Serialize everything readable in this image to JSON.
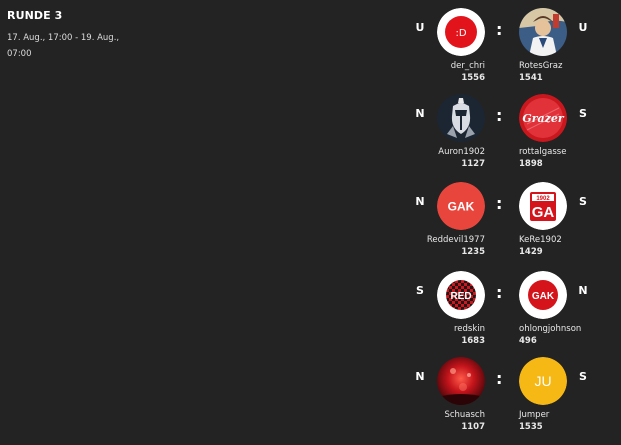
{
  "round": {
    "title": "RUNDE 3",
    "dates": "17. Aug., 17:00 - 19. Aug., 07:00"
  },
  "matches": [
    {
      "home": {
        "name": "der_chri",
        "rating": "1556",
        "result": "U",
        "avatar_icon": "smiley-text-avatar-icon",
        "avatar_text": ":D"
      },
      "away": {
        "name": "RotesGraz",
        "rating": "1541",
        "result": "U",
        "avatar_icon": "cartoon-character-avatar-icon"
      }
    },
    {
      "home": {
        "name": "Auron1902",
        "rating": "1127",
        "result": "N",
        "avatar_icon": "knight-avatar-icon"
      },
      "away": {
        "name": "rottalgasse",
        "rating": "1898",
        "result": "S",
        "avatar_icon": "grazer-club-badge-avatar-icon",
        "avatar_text": "Grazer"
      }
    },
    {
      "home": {
        "name": "Reddevil1977",
        "rating": "1235",
        "result": "N",
        "avatar_icon": "gak-text-avatar-icon",
        "avatar_text": "GAK"
      },
      "away": {
        "name": "KeRe1902",
        "rating": "1429",
        "result": "S",
        "avatar_icon": "ga-1902-badge-avatar-icon",
        "avatar_text": "GA",
        "avatar_year": "1902"
      }
    },
    {
      "home": {
        "name": "redskin",
        "rating": "1683",
        "result": "S",
        "avatar_icon": "red-checkered-avatar-icon",
        "avatar_text": "RED"
      },
      "away": {
        "name": "ohlongjohnson",
        "rating": "496",
        "result": "N",
        "avatar_icon": "gak-ring-avatar-icon",
        "avatar_text": "GAK"
      }
    },
    {
      "home": {
        "name": "Schuasch",
        "rating": "1107",
        "result": "N",
        "avatar_icon": "red-flare-photo-avatar-icon"
      },
      "away": {
        "name": "Jumper",
        "rating": "1535",
        "result": "S",
        "avatar_icon": "ju-initials-avatar-icon",
        "avatar_text": "JU"
      }
    }
  ],
  "colors": {
    "background": "#232323",
    "gak_red": "#e8453c",
    "club_red": "#d4131b",
    "jumper_yellow": "#f5b814",
    "knight_navy": "#1c2633"
  }
}
